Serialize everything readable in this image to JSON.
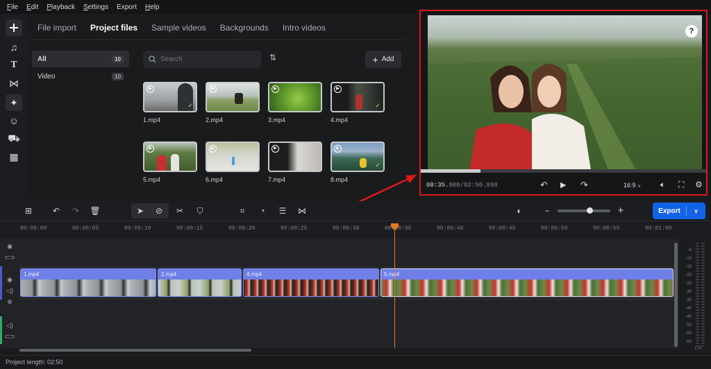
{
  "menu": [
    {
      "u": "F",
      "rest": "ile"
    },
    {
      "u": "E",
      "rest": "dit"
    },
    {
      "u": "P",
      "rest": "layback"
    },
    {
      "u": "S",
      "rest": "ettings"
    },
    {
      "u": "",
      "rest": "Export"
    },
    {
      "u": "H",
      "rest": "elp"
    }
  ],
  "tabs": {
    "file_import": "File import",
    "project_files": "Project files",
    "sample_videos": "Sample videos",
    "backgrounds": "Backgrounds",
    "intro_videos": "Intro videos"
  },
  "folders": {
    "all": {
      "label": "All",
      "count": "10"
    },
    "video": {
      "label": "Video",
      "count": "10"
    }
  },
  "search": {
    "placeholder": "Search"
  },
  "add_label": "Add",
  "files": [
    "1.mp4",
    "2.mp4",
    "3.mp4",
    "4.mp4",
    "5.mp4",
    "6.mp4",
    "7.mp4",
    "8.mp4"
  ],
  "player": {
    "time_current": "00:35.",
    "time_rest": "900/02:50.998",
    "aspect": "16:9",
    "progress": 0.21
  },
  "export": {
    "label": "Export"
  },
  "ruler": [
    "00:00:00",
    "00:00:05",
    "00:00:10",
    "00:00:15",
    "00:00:20",
    "00:00:25",
    "00:00:30",
    "00:00:35",
    "00:00:40",
    "00:00:45",
    "00:00:50",
    "00:00:55",
    "00:01:00"
  ],
  "clips": [
    "1.mp4",
    "2.mp4",
    "4.mp4",
    "5.mp4"
  ],
  "meter_labels": [
    "-5",
    "-10",
    "-15",
    "-20",
    "-25",
    "-30",
    "-35",
    "-40",
    "-45",
    "-50",
    "-55",
    "-60"
  ],
  "meter_lr": "L R",
  "status": {
    "project_length": "Project length: 02:50"
  },
  "colors": {
    "accent": "#1363e6",
    "clip": "#6f7fe8",
    "playhead": "#e5781f",
    "highlight": "#e01818"
  }
}
